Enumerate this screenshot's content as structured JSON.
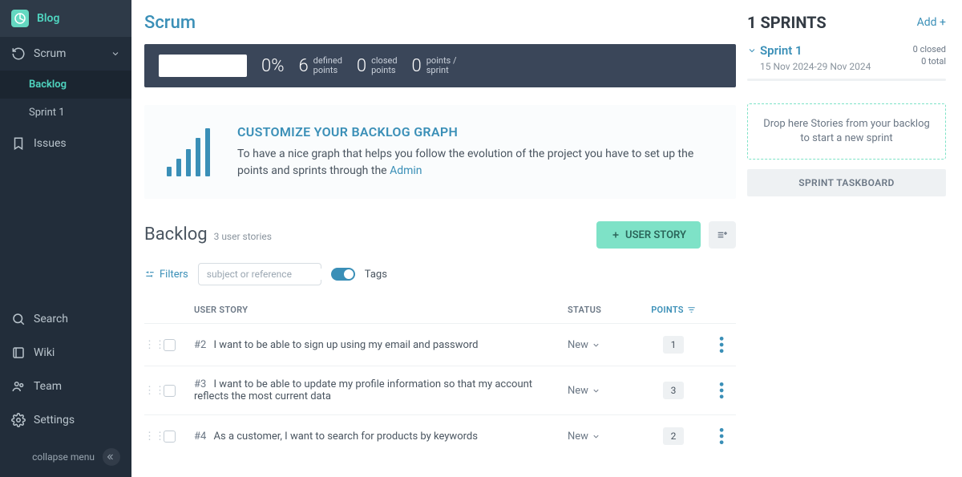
{
  "sidebar": {
    "blog": "Blog",
    "scrum": "Scrum",
    "sub": {
      "backlog": "Backlog",
      "sprint1": "Sprint 1"
    },
    "issues": "Issues",
    "search": "Search",
    "wiki": "Wiki",
    "team": "Team",
    "settings": "Settings",
    "collapse": "collapse menu"
  },
  "page": {
    "title": "Scrum"
  },
  "stats": {
    "percent": "0%",
    "defined_num": "6",
    "defined_label_1": "defined",
    "defined_label_2": "points",
    "closed_num": "0",
    "closed_label_1": "closed",
    "closed_label_2": "points",
    "sprint_num": "0",
    "sprint_label_1": "points /",
    "sprint_label_2": "sprint"
  },
  "customize": {
    "title": "CUSTOMIZE YOUR BACKLOG GRAPH",
    "text_1": "To have a nice graph that helps you follow the evolution of the project you have to set up the points and sprints through the ",
    "admin": "Admin"
  },
  "backlog": {
    "title": "Backlog",
    "count": "3 user stories",
    "add_btn": "USER STORY",
    "filters": "Filters",
    "search_placeholder": "subject or reference",
    "tags": "Tags",
    "columns": {
      "subject": "USER STORY",
      "status": "STATUS",
      "points": "POINTS"
    },
    "stories": [
      {
        "ref": "#2",
        "subject": "I want to be able to sign up using my email and password",
        "status": "New",
        "points": "1"
      },
      {
        "ref": "#3",
        "subject": "I want to be able to update my profile information so that my account reflects the most current data",
        "status": "New",
        "points": "3"
      },
      {
        "ref": "#4",
        "subject": "As a customer, I want to search for products by keywords",
        "status": "New",
        "points": "2"
      }
    ]
  },
  "sprints": {
    "title": "1 SPRINTS",
    "add": "Add +",
    "sprint": {
      "name": "Sprint 1",
      "dates": "15 Nov 2024-29 Nov 2024",
      "closed": "0 closed",
      "total": "0 total"
    },
    "dropzone": "Drop here Stories from your backlog to start a new sprint",
    "taskboard": "SPRINT TASKBOARD"
  }
}
